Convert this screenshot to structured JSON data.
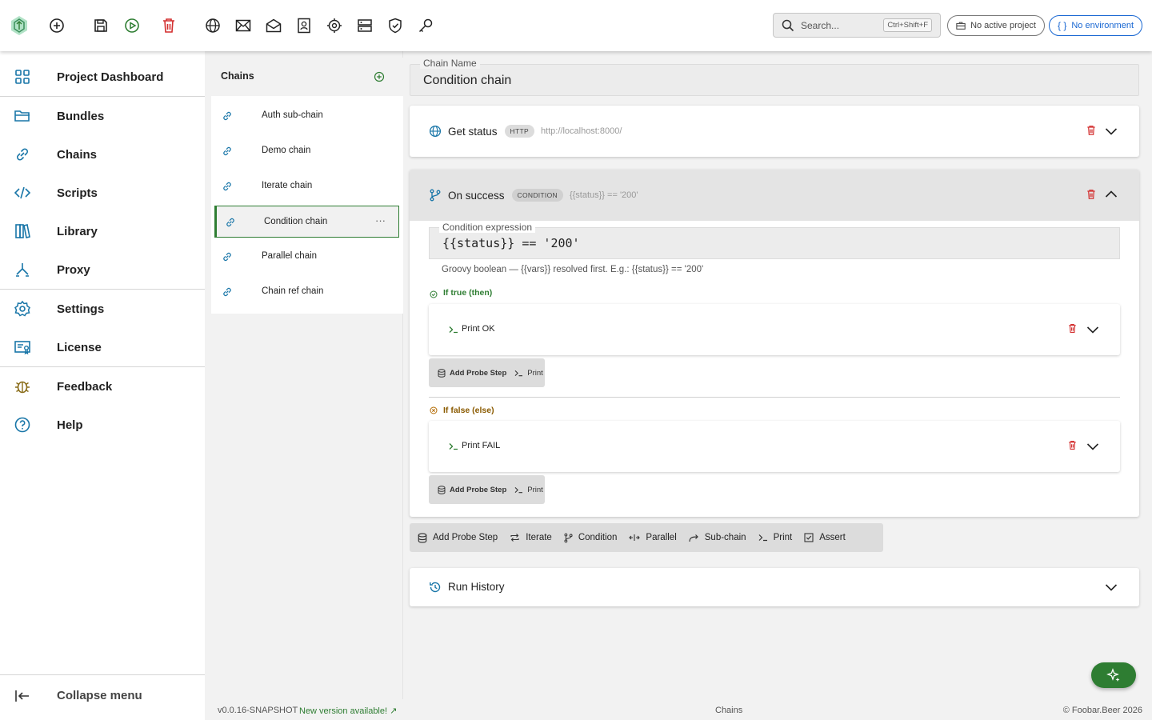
{
  "topbar": {
    "icons": [
      "app-logo-icon",
      "new-icon",
      "save-icon",
      "run-icon",
      "delete-icon",
      "globe-icon",
      "mail-icon",
      "mail-open-icon",
      "contacts-icon",
      "target-icon",
      "server-icon",
      "shield-check-icon",
      "key-icon"
    ],
    "search": {
      "placeholder": "Search...",
      "shortcut": "Ctrl+Shift+F"
    },
    "project": "No active project",
    "environment": "No environment"
  },
  "menu": {
    "items": [
      {
        "label": "Project Dashboard",
        "icon": "grid-icon"
      },
      {
        "label": "Bundles",
        "icon": "folder-icon"
      },
      {
        "label": "Chains",
        "icon": "link-icon"
      },
      {
        "label": "Scripts",
        "icon": "code-icon"
      },
      {
        "label": "Library",
        "icon": "library-icon"
      },
      {
        "label": "Proxy",
        "icon": "proxy-icon"
      },
      {
        "label": "Settings",
        "icon": "gear-icon"
      },
      {
        "label": "License",
        "icon": "certificate-icon"
      },
      {
        "label": "Feedback",
        "icon": "bug-icon"
      },
      {
        "label": "Help",
        "icon": "help-icon"
      }
    ],
    "collapse": "Collapse menu"
  },
  "chains": {
    "title": "Chains",
    "items": [
      "Auth sub-chain",
      "Demo chain",
      "Iterate chain",
      "Condition chain",
      "Parallel chain",
      "Chain ref chain"
    ],
    "active": "Condition chain",
    "more": "···"
  },
  "editor": {
    "name_label": "Chain Name",
    "name_value": "Condition chain",
    "step1": {
      "title": "Get status",
      "badge": "HTTP",
      "detail": "http://localhost:8000/"
    },
    "step2": {
      "title": "On success",
      "badge": "CONDITION",
      "detail": "{{status}} == '200'",
      "expr_label": "Condition expression",
      "expr_value": "{{status}} == '200'",
      "hint": "Groovy boolean — {{vars}} resolved first. E.g.: {{status}} == '200'",
      "then_label": "If true (then)",
      "then_step": "Print OK",
      "else_label": "If false (else)",
      "else_step": "Print FAIL",
      "add_probe": "Add Probe Step",
      "print": "Print"
    },
    "toolbar": [
      "Add Probe Step",
      "Iterate",
      "Condition",
      "Parallel",
      "Sub-chain",
      "Print",
      "Assert"
    ],
    "run_history": "Run History"
  },
  "footer": {
    "version": "v0.0.16-SNAPSHOT",
    "new_version": "New version available! ↗",
    "section": "Chains",
    "copyright": "© Foobar.Beer 2026"
  },
  "colors": {
    "accent": "#2e7d32",
    "link": "#1967d2",
    "danger": "#d32f2f",
    "menu_icon": "#1976a8"
  }
}
